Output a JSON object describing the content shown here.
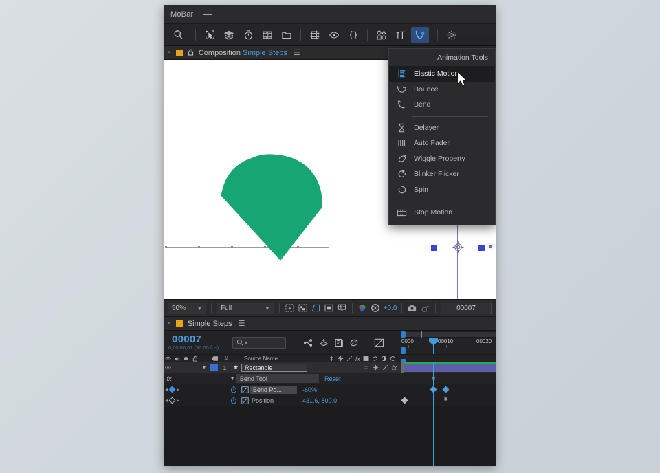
{
  "app": {
    "title": "MoBar",
    "menu_icon": "hamburger-icon"
  },
  "toolbar": {
    "items": [
      {
        "name": "search-icon",
        "label": "Search"
      },
      {
        "name": "select-region-icon",
        "label": "Select Region"
      },
      {
        "name": "layers-icon",
        "label": "Layers"
      },
      {
        "name": "stopwatch-icon",
        "label": "Timer"
      },
      {
        "name": "film-icon",
        "label": "Footage"
      },
      {
        "name": "folder-icon",
        "label": "Project Folder"
      },
      {
        "name": "frame-icon",
        "label": "Composition Frame"
      },
      {
        "name": "eye-icon",
        "label": "Visibility"
      },
      {
        "name": "expression-icon",
        "label": "Expressions"
      },
      {
        "name": "shapes-icon",
        "label": "Shapes"
      },
      {
        "name": "text-icon",
        "label": "Text"
      },
      {
        "name": "animation-tools-icon",
        "label": "Animation Tools"
      },
      {
        "name": "settings-icon",
        "label": "Settings"
      }
    ]
  },
  "animation_menu": {
    "title": "Animation Tools",
    "groups": [
      [
        {
          "label": "Elastic Motion",
          "icon": "elastic-motion-icon",
          "selected": true
        },
        {
          "label": "Bounce",
          "icon": "bounce-icon",
          "selected": false
        },
        {
          "label": "Bend",
          "icon": "bend-icon",
          "selected": false
        }
      ],
      [
        {
          "label": "Delayer",
          "icon": "hourglass-icon",
          "selected": false
        },
        {
          "label": "Auto Fader",
          "icon": "fader-icon",
          "selected": false
        },
        {
          "label": "Wiggle Property",
          "icon": "wiggle-icon",
          "selected": false
        },
        {
          "label": "Blinker Flicker",
          "icon": "blinker-icon",
          "selected": false
        },
        {
          "label": "Spin",
          "icon": "spin-icon",
          "selected": false
        }
      ],
      [
        {
          "label": "Stop Motion",
          "icon": "stop-motion-icon",
          "selected": false
        }
      ]
    ]
  },
  "composition_tab": {
    "close_label": "×",
    "lock_icon": "lock-icon",
    "prefix": "Composition",
    "name": "Simple Steps",
    "menu_icon": "panel-menu-icon"
  },
  "viewer": {
    "shape_color": "#18a574",
    "selection_color": "#3a46c8",
    "bottom_bar": {
      "zoom": "50%",
      "resolution": "Full",
      "exposure": "+0.0",
      "frame": "00007",
      "buttons": [
        {
          "name": "region-of-interest-icon",
          "active": false
        },
        {
          "name": "transparency-grid-icon",
          "active": false
        },
        {
          "name": "mask-guides-icon",
          "active": true
        },
        {
          "name": "title-safe-icon",
          "active": false
        },
        {
          "name": "3d-view-icon",
          "active": false
        },
        {
          "name": "channel-icon",
          "active": false
        },
        {
          "name": "exposure-icon",
          "active": false
        },
        {
          "name": "snapshot-icon",
          "active": false
        },
        {
          "name": "show-snapshot-icon",
          "active": false
        }
      ]
    }
  },
  "timeline": {
    "tab": {
      "close_label": "×",
      "name": "Simple Steps",
      "menu_icon": "panel-menu-icon"
    },
    "timecode": "00007",
    "timecode_sub": "0;00;00;07 (30.00 fps)",
    "search_placeholder": "",
    "search_icon": "search-icon",
    "header_buttons": [
      {
        "name": "composition-mini-flowchart-icon"
      },
      {
        "name": "draft-3d-icon"
      },
      {
        "name": "hide-shy-layers-icon"
      },
      {
        "name": "motion-blur-icon"
      },
      {
        "name": "graph-editor-icon"
      }
    ],
    "columns": {
      "source_name": "Source Name",
      "switch_icons": [
        "visibility-icon",
        "audio-icon",
        "solo-icon",
        "lock-icon"
      ],
      "label_icon": "label-icon",
      "index_icon": "index-icon"
    },
    "ruler": {
      "ticks": [
        "0000",
        "00010",
        "00020"
      ],
      "playhead_frame": "00007"
    },
    "layers": [
      {
        "index": "1",
        "name": "Rectangle",
        "star_icon": "star-icon",
        "switches": [
          "shy-icon",
          "collapse-icon",
          "quality-icon",
          "effects-icon"
        ],
        "properties": [
          {
            "name": "Bend Tool",
            "value": "Reset",
            "type": "effect",
            "indent": 1
          },
          {
            "name": "Bend Po...",
            "value": "-60%",
            "type": "property",
            "indent": 2,
            "stopwatch_on": true,
            "graph_icon": "graph-editor-icon",
            "keyframe_nav": true
          },
          {
            "name": "Position",
            "value": "431.6, 800.0",
            "type": "property",
            "indent": 2,
            "stopwatch_on": true,
            "graph_icon": "graph-editor-icon",
            "keyframe_nav": true
          }
        ]
      }
    ]
  }
}
